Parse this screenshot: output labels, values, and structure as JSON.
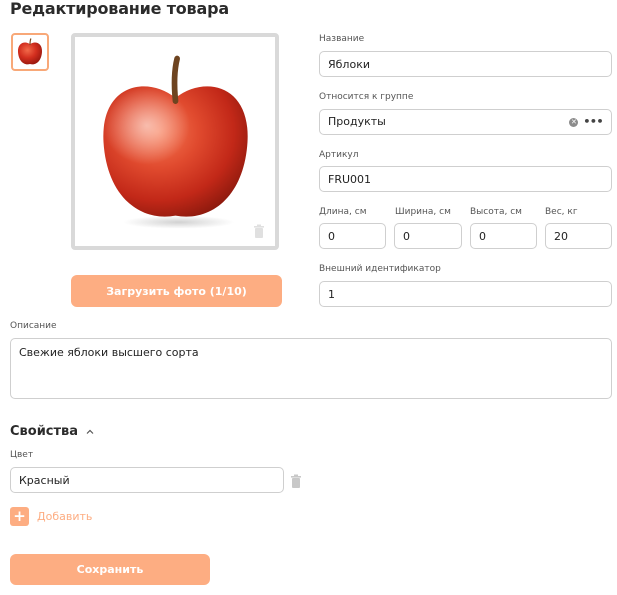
{
  "page": {
    "title": "Редактирование товара"
  },
  "photos": {
    "upload_label": "Загрузить фото (1/10)"
  },
  "fields": {
    "name": {
      "label": "Название",
      "value": "Яблоки"
    },
    "group": {
      "label": "Относится к группе",
      "value": "Продукты"
    },
    "sku": {
      "label": "Артикул",
      "value": "FRU001"
    },
    "length": {
      "label": "Длина, см",
      "value": "0"
    },
    "width": {
      "label": "Ширина, см",
      "value": "0"
    },
    "height": {
      "label": "Высота, см",
      "value": "0"
    },
    "weight": {
      "label": "Вес, кг",
      "value": "20"
    },
    "external_id": {
      "label": "Внешний идентификатор",
      "value": "1"
    },
    "description": {
      "label": "Описание",
      "value": "Свежие яблоки высшего сорта"
    }
  },
  "properties": {
    "title": "Свойства",
    "items": [
      {
        "label": "Цвет",
        "value": "Красный"
      }
    ],
    "add_label": "Добавить"
  },
  "actions": {
    "save_label": "Сохранить"
  },
  "colors": {
    "accent": "#fdad82",
    "thumb_border": "#f8a878",
    "frame_border": "#d9d9d9",
    "input_border": "#cfcfcf"
  },
  "icons": {
    "clear": "clear-icon",
    "more": "more-dots-icon",
    "trash": "trash-icon",
    "chevron": "chevron-up-icon",
    "plus": "plus-icon"
  }
}
